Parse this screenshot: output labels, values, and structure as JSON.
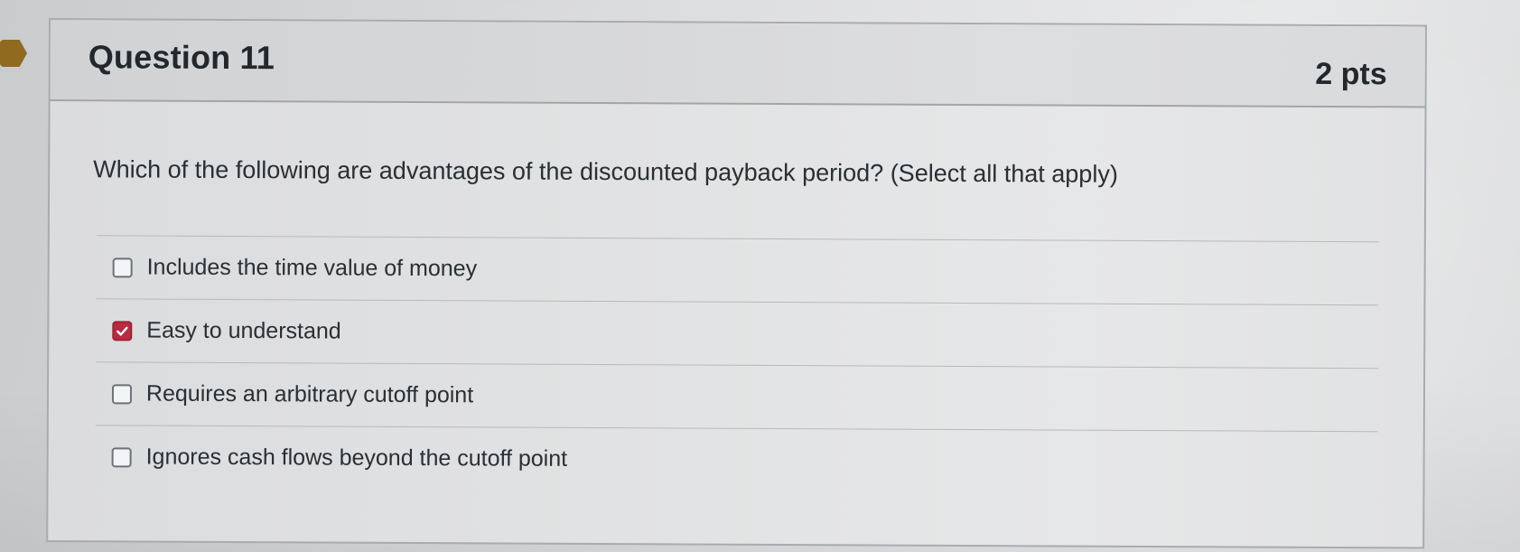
{
  "question": {
    "title": "Question 11",
    "points": "2 pts",
    "text": "Which of the following are advantages of the discounted payback period? (Select all that apply)"
  },
  "answers": [
    {
      "label": "Includes the time value of money",
      "checked": false
    },
    {
      "label": "Easy to understand",
      "checked": true
    },
    {
      "label": "Requires an arbitrary cutoff point",
      "checked": false
    },
    {
      "label": "Ignores cash flows beyond the cutoff point",
      "checked": false
    }
  ],
  "colors": {
    "checked_box": "#b92b42",
    "bookmark": "#8f6a1f",
    "text": "#2a2f33"
  },
  "icons": {
    "bookmark": "bookmark-flag-icon",
    "checkmark": "checkmark-icon"
  }
}
